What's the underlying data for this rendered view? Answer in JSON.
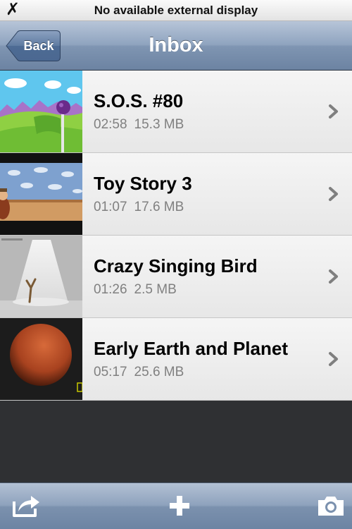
{
  "status_bar": {
    "left_glyph": "✗",
    "message": "No available external display"
  },
  "nav": {
    "back_label": "Back",
    "title": "Inbox"
  },
  "videos": [
    {
      "title": "S.O.S. #80",
      "duration": "02:58",
      "size": "15.3 MB",
      "thumbnail": "cartoon-green-hills"
    },
    {
      "title": "Toy Story 3",
      "duration": "01:07",
      "size": "17.6 MB",
      "thumbnail": "toy-story-bedroom"
    },
    {
      "title": "Crazy Singing Bird",
      "duration": "01:26",
      "size": "2.5 MB",
      "thumbnail": "spotlight-branch"
    },
    {
      "title": "Early Earth and Planet",
      "duration": "05:17",
      "size": "25.6 MB",
      "thumbnail": "red-planet"
    }
  ],
  "toolbar": {
    "icons": [
      "share-icon",
      "add-icon",
      "camera-icon"
    ]
  },
  "colors": {
    "nav_bar": "#8fa4bf",
    "row_background": "#f0f0f0",
    "meta_text": "#808080",
    "empty_background": "#2f3033"
  }
}
